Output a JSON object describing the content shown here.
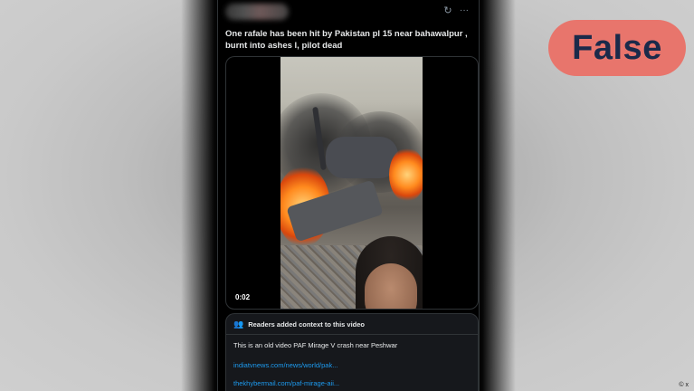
{
  "post": {
    "header_icons": {
      "refresh": "↻",
      "more": "···"
    },
    "text": "One rafale has been hit by Pakistan pl 15 near bahawalpur , burnt into ashes l, pilot dead",
    "video": {
      "timestamp": "0:02"
    },
    "context": {
      "icon": "👥",
      "title": "Readers added context to this video",
      "text": "This is an old video PAF Mirage V crash near Peshwar",
      "links": [
        "indiatvnews.com/news/world/pak...",
        "thekhybermail.com/paf-mirage-aii..."
      ]
    }
  },
  "verdict": {
    "label": "False",
    "color": "#e8756c"
  },
  "copyright": "© x"
}
